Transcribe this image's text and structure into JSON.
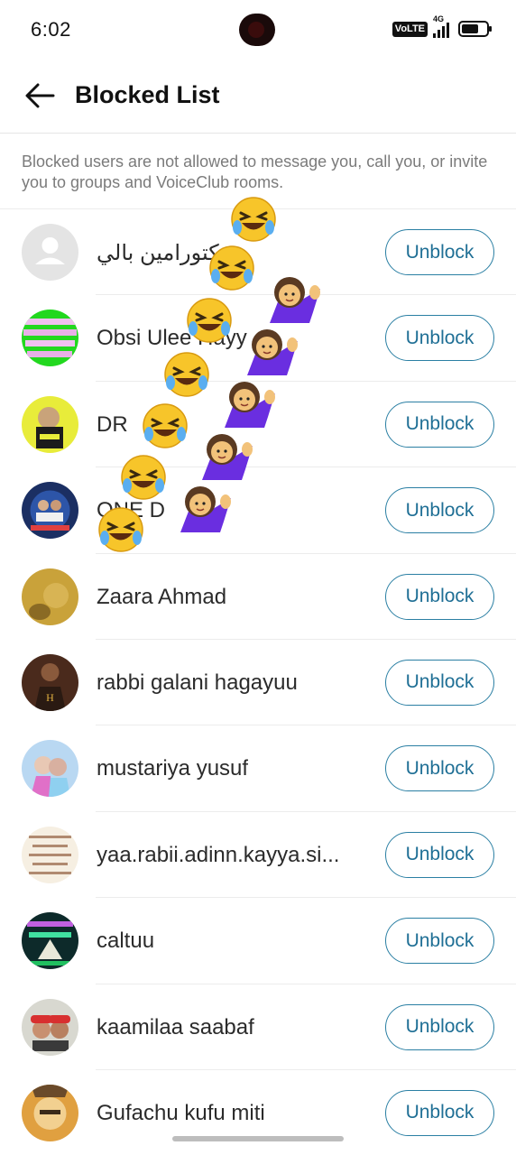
{
  "status_bar": {
    "time": "6:02",
    "volte_label": "VoLTE",
    "network_label": "4G"
  },
  "header": {
    "title": "Blocked List"
  },
  "info_text": "Blocked users are not allowed to message you, call you, or invite you to groups and VoiceClub rooms.",
  "colors": {
    "accent": "#1f6f95",
    "button_border": "#2a7fa3",
    "muted_text": "#7b7b7b"
  },
  "blocked_users": [
    {
      "name": "دكتورامين بالي",
      "unblock_label": "Unblock"
    },
    {
      "name": "Obsi Ulee Hayy",
      "unblock_label": "Unblock"
    },
    {
      "name": "DR",
      "unblock_label": "Unblock"
    },
    {
      "name": "ONE D",
      "unblock_label": "Unblock"
    },
    {
      "name": "Zaara Ahmad",
      "unblock_label": "Unblock"
    },
    {
      "name": "rabbi galani hagayuu",
      "unblock_label": "Unblock"
    },
    {
      "name": "mustariya yusuf",
      "unblock_label": "Unblock"
    },
    {
      "name": "yaa.rabii.adinn.kayya.si...",
      "unblock_label": "Unblock"
    },
    {
      "name": "caltuu",
      "unblock_label": "Unblock"
    },
    {
      "name": "kaamilaa saabaf",
      "unblock_label": "Unblock"
    },
    {
      "name": "Gufachu  kufu miti",
      "unblock_label": "Unblock"
    }
  ],
  "overlay_emojis": [
    "laughing-crying-emoji",
    "woman-tipping-hand-emoji"
  ]
}
